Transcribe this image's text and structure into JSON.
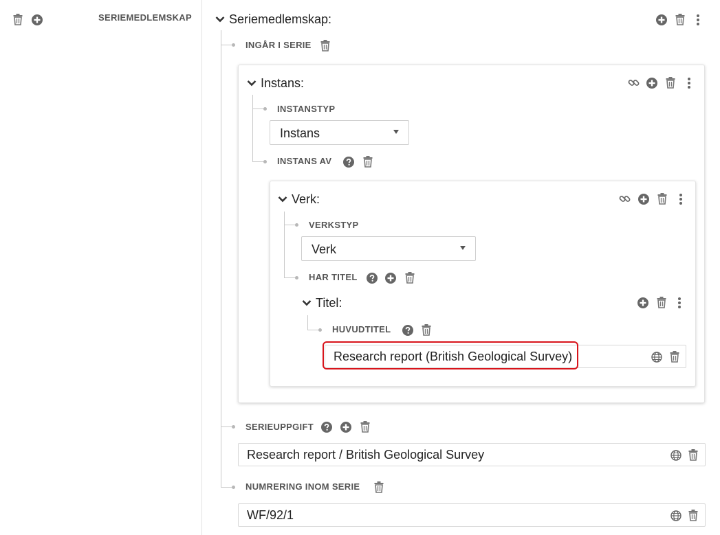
{
  "left": {
    "label": "SERIEMEDLEMSKAP"
  },
  "main": {
    "title": "Seriemedlemskap:",
    "ingar_label": "INGÅR I SERIE",
    "instans": {
      "title": "Instans:",
      "typ_label": "INSTANSTYP",
      "typ_value": "Instans",
      "av_label": "INSTANS AV",
      "verk": {
        "title": "Verk:",
        "typ_label": "VERKSTYP",
        "typ_value": "Verk",
        "titel_label": "HAR TITEL",
        "titel": {
          "title": "Titel:",
          "huvud_label": "HUVUDTITEL",
          "huvud_value": "Research report (British Geological Survey)"
        }
      }
    },
    "serieuppgift_label": "SERIEUPPGIFT",
    "serieuppgift_value": "Research report / British Geological Survey",
    "numrering_label": "NUMRERING INOM SERIE",
    "numrering_value": "WF/92/1"
  },
  "colors": {
    "highlight": "#d8141b",
    "icon": "#666666",
    "text": "#222222"
  }
}
